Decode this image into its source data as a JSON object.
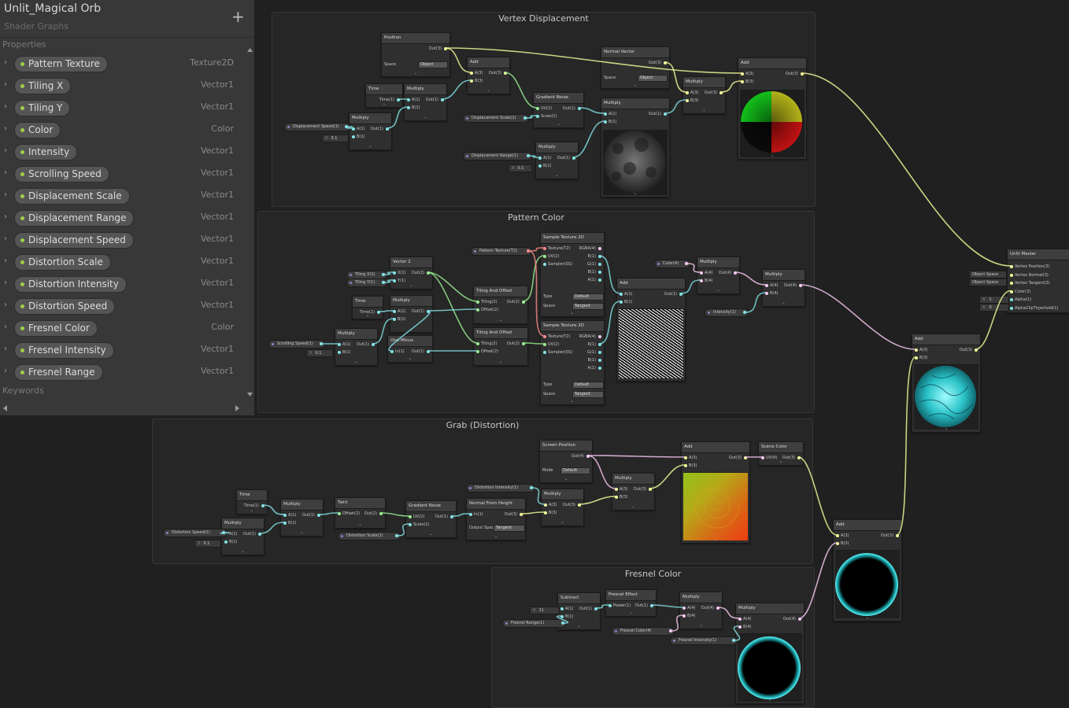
{
  "blackboard": {
    "title": "Unlit_Magical Orb",
    "subtitle": "Shader Graphs",
    "add_icon": "plus-icon",
    "properties_label": "Properties",
    "keywords_label": "Keywords",
    "properties": [
      {
        "name": "Pattern Texture",
        "type": "Texture2D"
      },
      {
        "name": "Tiling X",
        "type": "Vector1"
      },
      {
        "name": "Tiling Y",
        "type": "Vector1"
      },
      {
        "name": "Color",
        "type": "Color"
      },
      {
        "name": "Intensity",
        "type": "Vector1"
      },
      {
        "name": "Scrolling Speed",
        "type": "Vector1"
      },
      {
        "name": "Displacement Scale",
        "type": "Vector1"
      },
      {
        "name": "Displacement Range",
        "type": "Vector1"
      },
      {
        "name": "Displacement Speed",
        "type": "Vector1"
      },
      {
        "name": "Distortion Scale",
        "type": "Vector1"
      },
      {
        "name": "Distortion Intensity",
        "type": "Vector1"
      },
      {
        "name": "Distortion Speed",
        "type": "Vector1"
      },
      {
        "name": "Fresnel Color",
        "type": "Color"
      },
      {
        "name": "Fresnel Intensity",
        "type": "Vector1"
      },
      {
        "name": "Fresnel Range",
        "type": "Vector1"
      }
    ]
  },
  "groups": {
    "vertex": "Vertex Displacement",
    "pattern": "Pattern Color",
    "grab": "Grab (Distortion)",
    "fresnel": "Fresnel Color"
  },
  "nodes": {
    "position": {
      "title": "Position",
      "out": "Out(3)",
      "space_label": "Space",
      "space_value": "Object"
    },
    "add1": {
      "title": "Add",
      "a": "A(3)",
      "b": "B(3)",
      "out": "Out(3)"
    },
    "time1": {
      "title": "Time",
      "out": "Time(1)"
    },
    "mul_time1": {
      "title": "Multiply",
      "a": "A(1)",
      "b": "B(1)",
      "out": "Out(1)"
    },
    "mul_dspeed": {
      "title": "Multiply",
      "a": "A(1)",
      "b": "B(1)",
      "out": "Out(1)"
    },
    "gradient1": {
      "title": "Gradient Noise",
      "uv": "UV(2)",
      "scale": "Scale(1)",
      "out": "Out(1)"
    },
    "normal_vector": {
      "title": "Normal Vector",
      "out": "Out(3)",
      "space_label": "Space",
      "space_value": "Object"
    },
    "mul_noise": {
      "title": "Multiply",
      "a": "A(1)",
      "b": "B(1)",
      "out": "Out(1)"
    },
    "mul_range": {
      "title": "Multiply",
      "a": "A(1)",
      "b": "B(1)",
      "out": "Out(1)"
    },
    "mul_normal": {
      "title": "Multiply",
      "a": "A(3)",
      "b": "B(3)",
      "out": "Out(3)"
    },
    "add_vertex": {
      "title": "Add",
      "a": "A(3)",
      "b": "B(3)",
      "out": "Out(3)"
    },
    "vector2": {
      "title": "Vector 2",
      "x": "X(1)",
      "y": "Y(1)",
      "out": "Out(2)"
    },
    "time2": {
      "title": "Time",
      "out": "Time(1)"
    },
    "mul_scroll2": {
      "title": "Multiply",
      "a": "A(1)",
      "b": "B(1)",
      "out": "Out(1)"
    },
    "mul_scroll": {
      "title": "Multiply",
      "a": "A(1)",
      "b": "B(1)",
      "out": "Out(1)"
    },
    "one_minus": {
      "title": "One Minus",
      "in": "In(1)",
      "out": "Out(1)"
    },
    "tiling1": {
      "title": "Tiling And Offset",
      "tiling": "Tiling(2)",
      "offset": "Offset(2)",
      "out": "Out(2)"
    },
    "tiling2": {
      "title": "Tiling And Offset",
      "tiling": "Tiling(2)",
      "offset": "Offset(2)",
      "out": "Out(2)"
    },
    "sample1": {
      "title": "Sample Texture 2D",
      "tex": "Texture(T2)",
      "uv": "UV(2)",
      "sampler": "Sampler(SS)",
      "rgba": "RGBA(4)",
      "r": "R(1)",
      "g": "G(1)",
      "b": "B(1)",
      "a": "A(1)",
      "type_label": "Type",
      "type_value": "Default",
      "space_label": "Space",
      "space_value": "Tangent"
    },
    "sample2": {
      "title": "Sample Texture 2D",
      "tex": "Texture(T2)",
      "uv": "UV(2)",
      "sampler": "Sampler(SS)",
      "rgba": "RGBA(4)",
      "r": "R(1)",
      "g": "G(1)",
      "b": "B(1)",
      "a": "A(1)",
      "type_label": "Type",
      "type_value": "Default",
      "space_label": "Space",
      "space_value": "Tangent"
    },
    "add_pattern": {
      "title": "Add",
      "a": "A(1)",
      "b": "B(1)",
      "out": "Out(1)"
    },
    "mul_color": {
      "title": "Multiply",
      "a": "A(4)",
      "b": "B(4)",
      "out": "Out(4)"
    },
    "mul_intensity": {
      "title": "Multiply",
      "a": "A(4)",
      "b": "B(4)",
      "out": "Out(4)"
    },
    "time3": {
      "title": "Time",
      "out": "Time(1)"
    },
    "mul_dist_speed": {
      "title": "Multiply",
      "a": "A(1)",
      "b": "B(1)",
      "out": "Out(1)"
    },
    "mul_time3": {
      "title": "Multiply",
      "a": "A(1)",
      "b": "B(1)",
      "out": "Out(1)"
    },
    "twirl": {
      "title": "Twirl",
      "offset": "Offset(2)",
      "out": "Out(2)"
    },
    "gradient2": {
      "title": "Gradient Noise",
      "uv": "UV(2)",
      "scale": "Scale(1)",
      "out": "Out(1)"
    },
    "normal_height": {
      "title": "Normal From Height",
      "in": "In(1)",
      "out": "Out(3)",
      "space_label": "Output Space",
      "space_value": "Tangent"
    },
    "mul_dist_int": {
      "title": "Multiply",
      "a": "A(3)",
      "b": "B(3)",
      "out": "Out(3)"
    },
    "screen_pos": {
      "title": "Screen Position",
      "out": "Out(4)",
      "mode_label": "Mode",
      "mode_value": "Default"
    },
    "mul_screen": {
      "title": "Multiply",
      "a": "A(3)",
      "b": "B(3)",
      "out": "Out(3)"
    },
    "add_grab": {
      "title": "Add",
      "a": "A(3)",
      "b": "B(3)",
      "out": "Out(3)"
    },
    "scene_color": {
      "title": "Scene Color",
      "uv": "UV(4)",
      "out": "Out(3)"
    },
    "add_grab_pattern": {
      "title": "Add",
      "a": "A(3)",
      "b": "B(3)",
      "out": "Out(3)"
    },
    "add_final": {
      "title": "Add",
      "a": "A(3)",
      "b": "B(3)",
      "out": "Out(3)"
    },
    "subtract": {
      "title": "Subtract",
      "a": "A(1)",
      "b": "B(1)",
      "out": "Out(1)"
    },
    "fresnel": {
      "title": "Fresnel Effect",
      "power": "Power(1)",
      "out": "Out(1)"
    },
    "mul_fcolor": {
      "title": "Multiply",
      "a": "A(4)",
      "b": "B(4)",
      "out": "Out(4)"
    },
    "mul_fint": {
      "title": "Multiply",
      "a": "A(4)",
      "b": "B(4)",
      "out": "Out(4)"
    },
    "master": {
      "title": "Unlit Master",
      "ports": [
        "Vertex Position(3)",
        "Vertex Normal(3)",
        "Vertex Tangent(3)",
        "Color(3)",
        "Alpha(1)",
        "AlphaClipThreshold(1)"
      ]
    }
  },
  "property_nodes": {
    "disp_speed": "Displacement Speed(1)",
    "disp_scale": "Displacement Scale(1)",
    "disp_range": "Displacement Range(1)",
    "pattern_tex": "Pattern Texture(T2)",
    "tiling_x": "Tiling X(1)",
    "tiling_y": "Tiling Y(1)",
    "scroll_speed": "Scrolling Speed(1)",
    "color": "Color(4)",
    "intensity": "Intensity(1)",
    "dist_speed": "Distortion Speed(1)",
    "dist_scale": "Distortion Scale(1)",
    "dist_intensity": "Distortion Intensity(1)",
    "fresnel_range": "Fresnel Range(1)",
    "fresnel_color": "Fresnel Color(4)",
    "fresnel_intensity": "Fresnel Intensity(1)"
  },
  "inline_values": {
    "x_label": "X",
    "v01": "0.1",
    "v11": "11",
    "v1": "1",
    "v0": "0",
    "object_space": "Object Space"
  },
  "colors": {
    "float_port": "#84e4e7",
    "vec2_port": "#9aef92",
    "vec3_port": "#f6ff9a",
    "vec4_port": "#fbcbf4",
    "tex_port": "#ff8b8b",
    "accent_green": "#9ed046"
  }
}
